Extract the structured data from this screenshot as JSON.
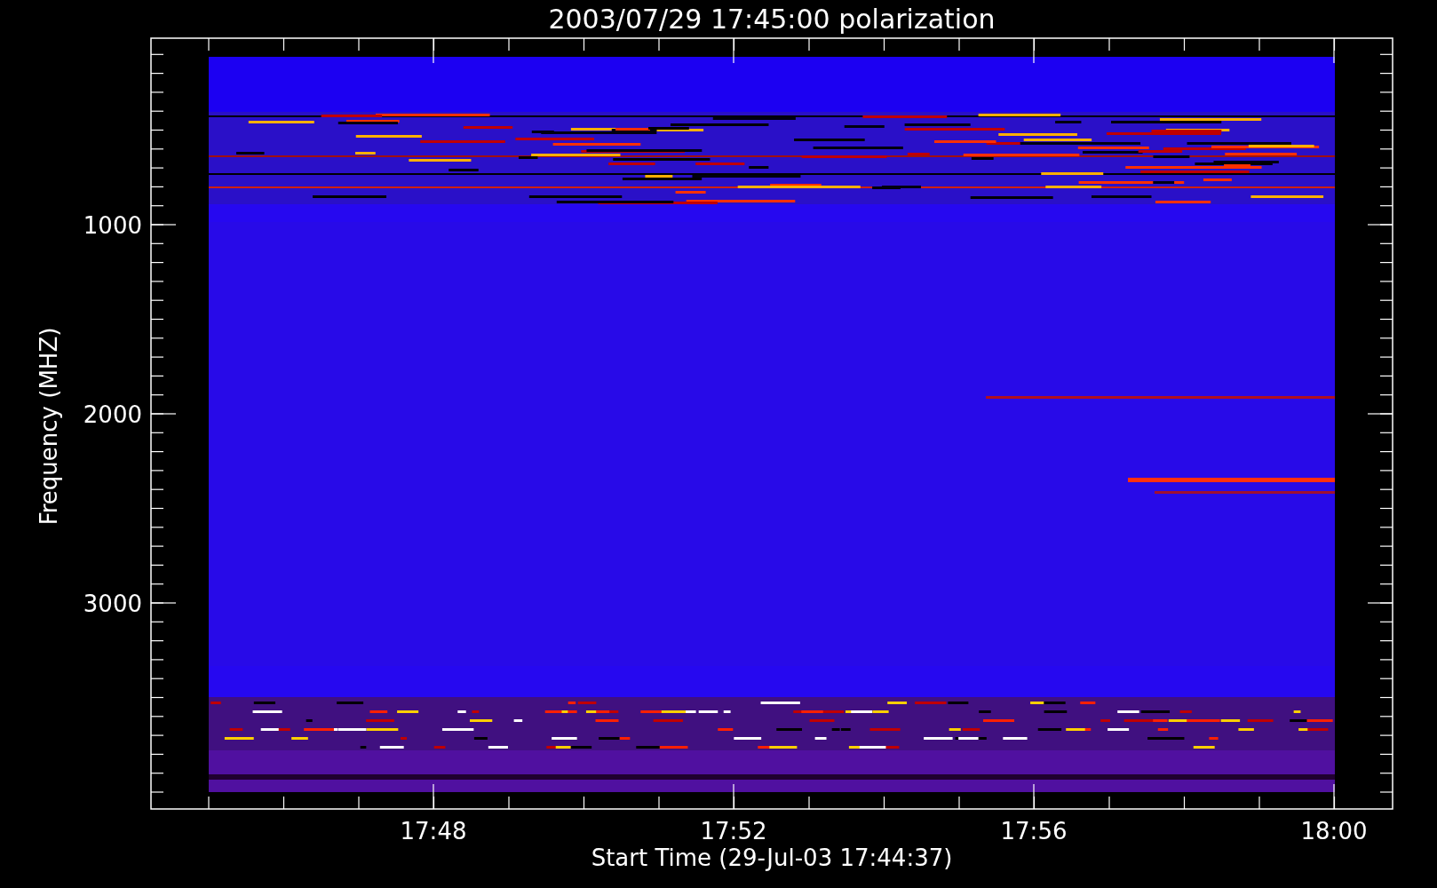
{
  "title": "2003/07/29 17:45:00 polarization",
  "y_axis": {
    "label": "Frequency (MHZ)",
    "ticks": [
      "1000",
      "2000",
      "3000"
    ]
  },
  "x_axis": {
    "label": "Start Time (29-Jul-03 17:44:37)",
    "ticks": [
      "17:48",
      "17:52",
      "17:56",
      "18:00"
    ]
  }
}
